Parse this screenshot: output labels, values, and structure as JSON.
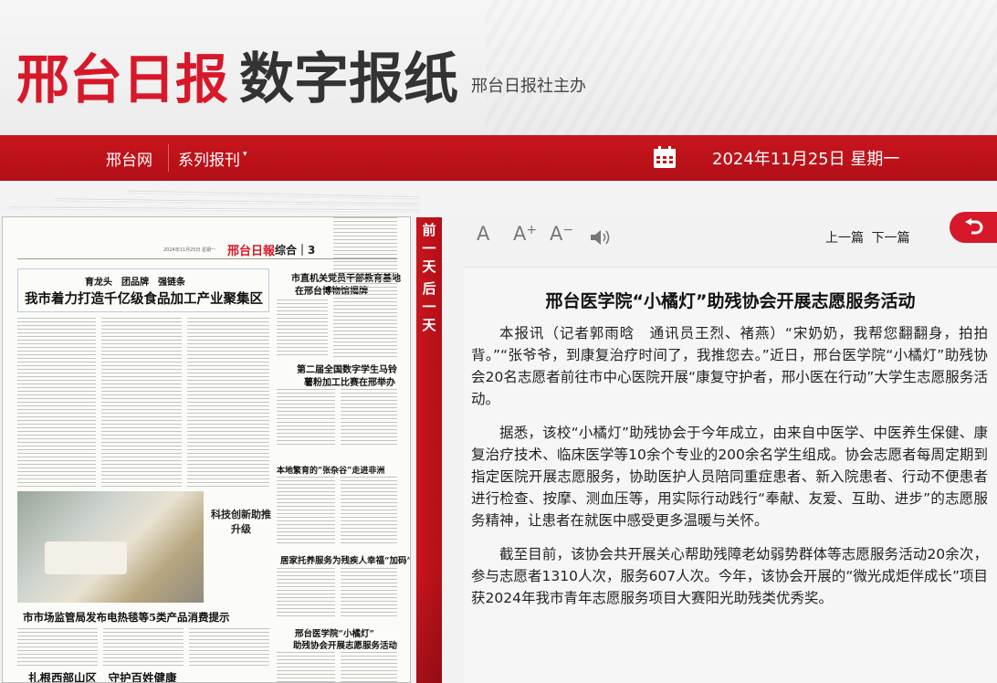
{
  "header": {
    "logo_red": "邢台日报",
    "logo_dark": "数字报纸",
    "subtitle": "邢台日报社主办"
  },
  "nav": {
    "home": "邢台网",
    "series": "系列报刊",
    "date": "2024年11月25日  星期一",
    "calendar_icon": "calendar-icon"
  },
  "side_strip": {
    "prev_day": "前一天",
    "next_day": "后一天"
  },
  "toolbar": {
    "font_normal": "A",
    "font_plus": "A",
    "plus_sign": "+",
    "font_minus": "A",
    "minus_sign": "−",
    "prev_article": "上一篇",
    "next_article": "下一篇",
    "back_icon": "back-arrow-icon"
  },
  "paper": {
    "masthead_date": "2024年11月25日 星期一",
    "brand": "邢台日報",
    "section": "综合｜3",
    "kicker": "育龙头　团品牌　强链条",
    "headline_main": "我市着力打造千亿级食品加工产业聚集区",
    "headline_right1": "市直机关党员干部教育基地",
    "headline_right2": "在邢台博物馆揭牌",
    "headline_right3": "第二届全国数字学生马铃",
    "headline_right4": "薯粉加工比赛在邢举办",
    "headline_right5": "本地繁育的“张杂谷”走进非洲",
    "photo_caption": "科技创新助推升级",
    "headline_right6": "居家托养服务为残疾人幸福“加码”",
    "headline_bottom1": "市市场监管局发布电热毯等5类产品消费提示",
    "headline_bottom2": "邢台医学院“小橘灯”",
    "headline_bottom3": "助残协会开展志愿服务活动",
    "headline_bottom4": "扎根西部山区　守护百姓健康"
  },
  "article": {
    "title": "邢台医学院“小橘灯”助残协会开展志愿服务活动",
    "paragraphs": [
      "本报讯（记者郭雨晗　通讯员王烈、褚燕）“宋奶奶，我帮您翻翻身，拍拍背。”“张爷爷，到康复治疗时间了，我推您去。”近日，邢台医学院“小橘灯”助残协会20名志愿者前往市中心医院开展“康复守护者，邢小医在行动”大学生志愿服务活动。",
      "据悉，该校“小橘灯”助残协会于今年成立，由来自中医学、中医养生保健、康复治疗技术、临床医学等10余个专业的200余名学生组成。协会志愿者每周定期到指定医院开展志愿服务，协助医护人员陪同重症患者、新入院患者、行动不便患者进行检查、按摩、测血压等，用实际行动践行“奉献、友爱、互助、进步”的志愿服务精神，让患者在就医中感受更多温暖与关怀。",
      "截至目前，该协会共开展关心帮助残障老幼弱势群体等志愿服务活动20余次，参与志愿者1310人次，服务607人次。今年，该协会开展的“微光成炬伴成长”项目获2024年我市青年志愿服务项目大赛阳光助残类优秀奖。"
    ]
  }
}
